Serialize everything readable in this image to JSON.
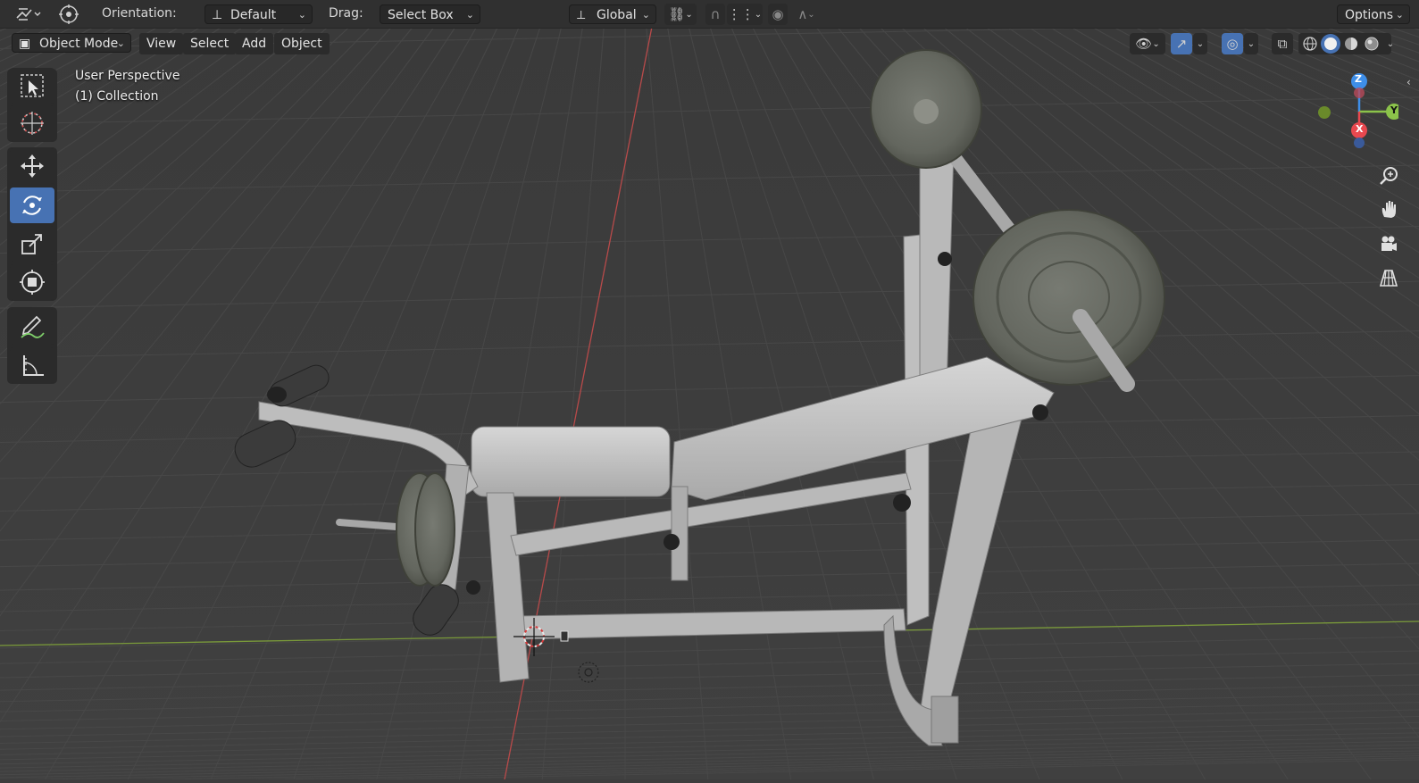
{
  "header": {
    "orientation_label": "Orientation:",
    "orientation_value": "Default",
    "drag_label": "Drag:",
    "drag_value": "Select Box",
    "transform_space": "Global",
    "options_label": "Options"
  },
  "menubar": {
    "mode": "Object Mode",
    "items": [
      "View",
      "Select",
      "Add",
      "Object"
    ]
  },
  "overlay": {
    "perspective": "User Perspective",
    "collection": "(1) Collection"
  },
  "gizmo": {
    "z": "Z",
    "y": "Y",
    "x": "X"
  },
  "tools": [
    "select-box",
    "cursor",
    "move",
    "rotate",
    "scale",
    "transform",
    "annotate",
    "measure"
  ],
  "active_tool": "rotate",
  "colors": {
    "accent": "#4772b3",
    "x_axis": "#e8484f",
    "y_axis": "#8bc34a",
    "z_axis": "#3e8ee8",
    "viewport_bg": "#3d3d3d"
  }
}
